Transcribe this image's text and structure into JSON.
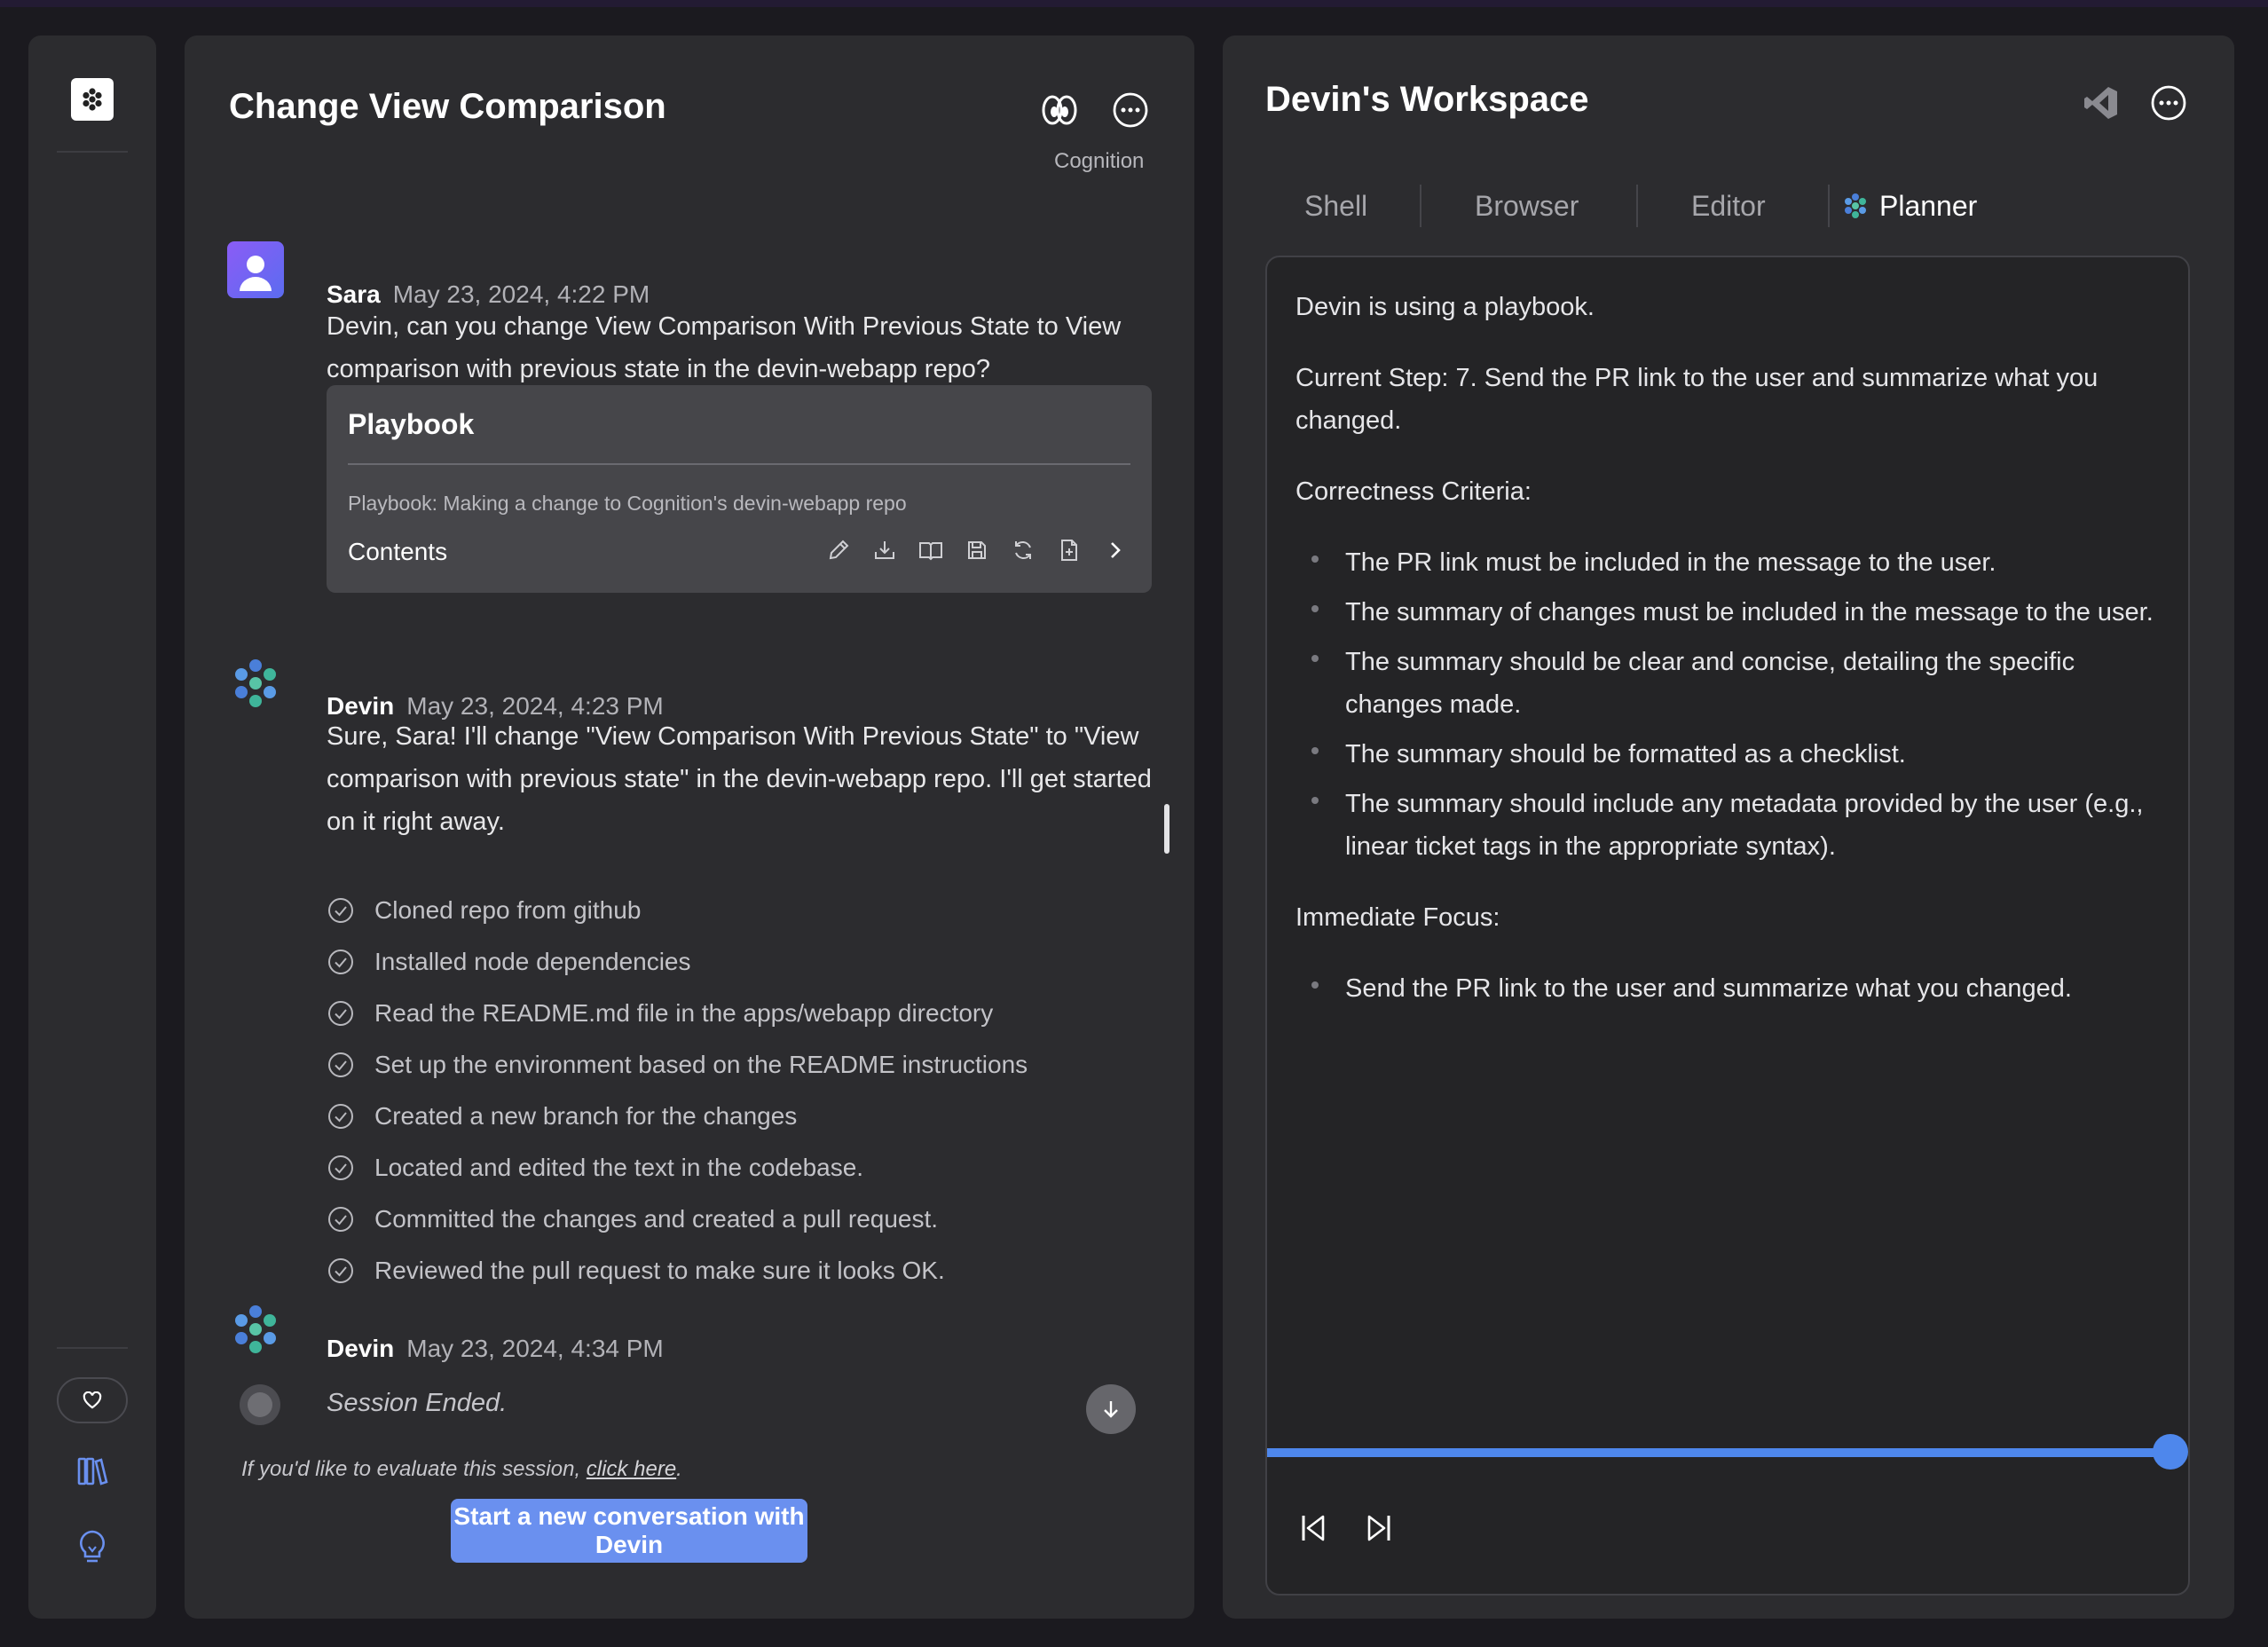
{
  "chat": {
    "title": "Change View Comparison",
    "org_label": "Cognition",
    "messages": [
      {
        "author": "Sara",
        "time": "May 23, 2024, 4:22 PM",
        "text": "Devin, can you change View Comparison With Previous State to View comparison with previous state in the devin-webapp repo?"
      },
      {
        "author": "Devin",
        "time": "May 23, 2024, 4:23 PM",
        "text": "Sure, Sara! I'll change \"View Comparison With Previous State\" to \"View comparison with previous state\" in the devin-webapp repo. I'll get started on it right away."
      },
      {
        "author": "Devin",
        "time": "May 23, 2024, 4:34 PM"
      }
    ],
    "playbook": {
      "title": "Playbook",
      "description": "Playbook: Making a change to Cognition's devin-webapp repo",
      "contents_label": "Contents",
      "tools": [
        "edit-icon",
        "download-icon",
        "book-open-icon",
        "save-icon",
        "refresh-icon",
        "file-plus-icon",
        "chevron-right-icon"
      ]
    },
    "steps": [
      "Cloned repo from github",
      "Installed node dependencies",
      "Read the README.md file in the apps/webapp directory",
      "Set up the environment based on the README instructions",
      "Created a new branch for the changes",
      "Located and edited the text in the codebase.",
      "Committed the changes and created a pull request.",
      "Reviewed the pull request to make sure it looks OK."
    ],
    "session_ended": "Session Ended.",
    "evaluate_prefix": "If you'd like to evaluate this session, ",
    "evaluate_link": "click here",
    "evaluate_suffix": ".",
    "new_conversation_label": "Start a new conversation with Devin"
  },
  "workspace": {
    "title": "Devin's Workspace",
    "tabs": [
      "Shell",
      "Browser",
      "Editor",
      "Planner"
    ],
    "active_tab": "Planner",
    "planner": {
      "intro": "Devin is using a playbook.",
      "current_step": "Current Step: 7. Send the PR link to the user and summarize what you changed.",
      "criteria_heading": "Correctness Criteria:",
      "criteria": [
        "The PR link must be included in the message to the user.",
        "The summary of changes must be included in the message to the user.",
        "The summary should be clear and concise, detailing the specific changes made.",
        "The summary should be formatted as a checklist.",
        "The summary should include any metadata provided by the user (e.g., linear ticket tags in the appropriate syntax)."
      ],
      "focus_heading": "Immediate Focus:",
      "focus": [
        "Send the PR link to the user and summarize what you changed."
      ]
    },
    "timeline_progress": 1.0
  },
  "colors": {
    "accent": "#4e87ec",
    "button": "#6a90ef",
    "panel": "#2c2c2f",
    "background": "#1b1a1f"
  }
}
